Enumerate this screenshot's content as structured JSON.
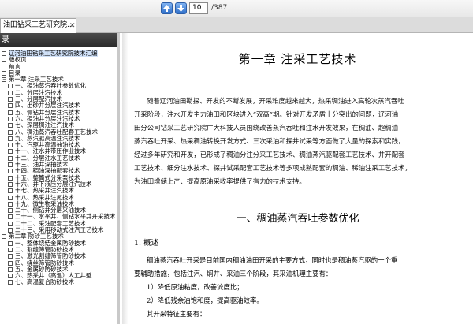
{
  "toolbar": {
    "prev_icon": "arrow-up-icon",
    "next_icon": "arrow-down-icon",
    "page_current": "10",
    "page_total": "/387"
  },
  "tab": {
    "title": "油田钻采工艺研究院...",
    "close": "✕"
  },
  "sidebar": {
    "header": "录",
    "items": [
      {
        "label": "辽河油田钻采工艺研究院技术汇编",
        "indent": 0,
        "expand": "",
        "selected": true
      },
      {
        "label": "版权页",
        "indent": 0,
        "expand": ""
      },
      {
        "label": "前言",
        "indent": 0,
        "expand": ""
      },
      {
        "label": "目录",
        "indent": 0,
        "expand": ""
      },
      {
        "label": "第一章 注采工艺技术",
        "indent": 0,
        "expand": "−"
      },
      {
        "label": "一、稠油蒸汽吞吐参数优化",
        "indent": 1,
        "expand": ""
      },
      {
        "label": "二、分层注汽技术",
        "indent": 1,
        "expand": ""
      },
      {
        "label": "三、分层配汽技术",
        "indent": 1,
        "expand": ""
      },
      {
        "label": "四、出砂井分层注汽技术",
        "indent": 1,
        "expand": ""
      },
      {
        "label": "五、侧钻井分层注汽技术",
        "indent": 1,
        "expand": ""
      },
      {
        "label": "六、稠油井分层注汽技术",
        "indent": 1,
        "expand": ""
      },
      {
        "label": "七、深层稠油注汽技术",
        "indent": 1,
        "expand": ""
      },
      {
        "label": "八、稠油蒸汽吞吐配套工艺技术",
        "indent": 1,
        "expand": ""
      },
      {
        "label": "九、蒸汽驱高温注汽技术",
        "indent": 1,
        "expand": ""
      },
      {
        "label": "十、汽驱井高温抽油技术",
        "indent": 1,
        "expand": ""
      },
      {
        "label": "十一、注水井带压作业技术",
        "indent": 1,
        "expand": ""
      },
      {
        "label": "十二、分层注水工艺技术",
        "indent": 1,
        "expand": ""
      },
      {
        "label": "十三、油井深抽技术",
        "indent": 1,
        "expand": ""
      },
      {
        "label": "十四、稠油深抽配套技术",
        "indent": 1,
        "expand": ""
      },
      {
        "label": "十五、整筒式分采泵技术",
        "indent": 1,
        "expand": ""
      },
      {
        "label": "十六、井下液压分层注汽技术",
        "indent": 1,
        "expand": ""
      },
      {
        "label": "十七、热采井注汽技术",
        "indent": 1,
        "expand": ""
      },
      {
        "label": "十八、热采井注氮技术",
        "indent": 1,
        "expand": ""
      },
      {
        "label": "十九、微生物采油技术",
        "indent": 1,
        "expand": ""
      },
      {
        "label": "二十、侧钻井分层采油技术",
        "indent": 1,
        "expand": ""
      },
      {
        "label": "二十一、水平井、侧钻水平井开采技术",
        "indent": 1,
        "expand": ""
      },
      {
        "label": "二十二、采油配套工艺技术",
        "indent": 1,
        "expand": ""
      },
      {
        "label": "二十三、采用移动式注汽工艺技术",
        "indent": 1,
        "expand": ""
      },
      {
        "label": "第二章 防砂工艺技术",
        "indent": 0,
        "expand": "−"
      },
      {
        "label": "一、整体烧结金属防砂技术",
        "indent": 1,
        "expand": ""
      },
      {
        "label": "二、割缝筛管防砂技术",
        "indent": 1,
        "expand": ""
      },
      {
        "label": "三、激光割缝筛管防砂技术",
        "indent": 1,
        "expand": ""
      },
      {
        "label": "四、绕丝筛管防砂技术",
        "indent": 1,
        "expand": ""
      },
      {
        "label": "五、金属砂防砂技术",
        "indent": 1,
        "expand": ""
      },
      {
        "label": "六、热采井（高温）人工井壁",
        "indent": 1,
        "expand": ""
      },
      {
        "label": "七、高温复合防砂技术",
        "indent": 1,
        "expand": ""
      }
    ]
  },
  "document": {
    "chapter_title": "第一章 注采工艺技术",
    "intro_lines": [
      "随着辽河油田勘探、开发的不断发展，开采难度越来越大，热采稠油进入高轮次蒸汽吞吐",
      "开采阶段，注水开发主力油田和区块进入“双高”期。针对开发矛盾十分突出的问题，辽河油",
      "田分公司钻采工艺研究院广大科技人员围绕改善蒸汽吞吐和注水开发效果，在稠油、超稠油",
      "蒸汽吞吐开采、热采稠油转换开发方式、三次采油和探井试采等方面做了大量的探索和实践，",
      "经过多年研究和开发，已形成了稠油分注分采工艺技术、稠油蒸汽驱配套工艺技术、井开配套",
      "工艺技术、细分注水技术、探井试采配套工艺技术等多项成熟配套的稠油、稀油注采工艺技术，",
      "为油田增储上产、提高原油采收率提供了有力的技术支持。"
    ],
    "section_title": "一、稠油蒸汽吞吐参数优化",
    "subsection_title": "1. 概述",
    "body_lines": [
      "稠油蒸汽吞吐开采是目前国内稠油油田开采的主要方式，同时也是稠油蒸汽驱的一个重",
      "要辅助措施，包括注汽、焖井、采油三个阶段，其采油机理主要有：",
      "1）降低原油粘度，改善流度比；",
      "2）降低残余油饱和度，提高驱油效率。",
      "其开采特征主要有："
    ]
  }
}
